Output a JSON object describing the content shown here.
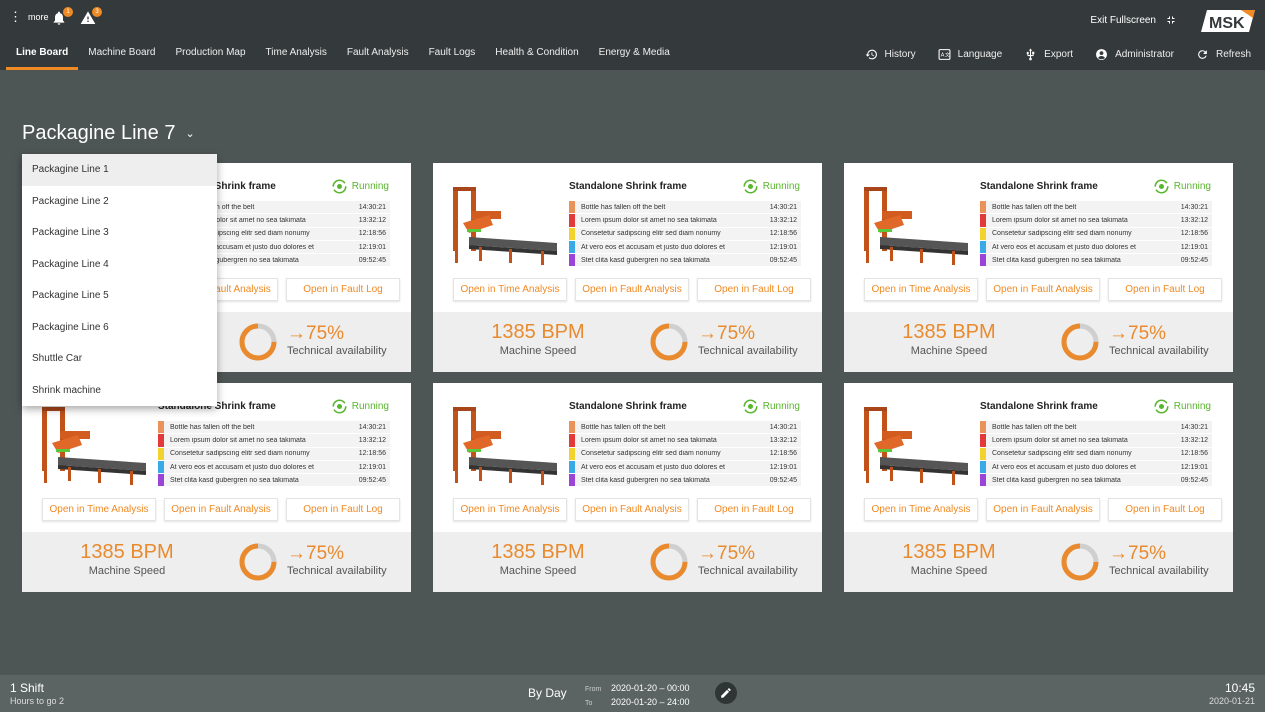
{
  "header": {
    "more_label": "more",
    "notification_count": "1",
    "warning_count": "3",
    "exit_fullscreen": "Exit Fullscreen",
    "logo": "MSK",
    "tabs": [
      {
        "label": "Line Board",
        "active": true
      },
      {
        "label": "Machine Board"
      },
      {
        "label": "Production Map"
      },
      {
        "label": "Time Analysis"
      },
      {
        "label": "Fault Analysis"
      },
      {
        "label": "Fault Logs"
      },
      {
        "label": "Health & Condition"
      },
      {
        "label": "Energy & Media"
      }
    ],
    "tools": {
      "history": "History",
      "language": "Language",
      "export": "Export",
      "user": "Administrator",
      "refresh": "Refresh"
    }
  },
  "page": {
    "title": "Packagine Line 7"
  },
  "dropdown": {
    "items": [
      "Packagine Line 1",
      "Packagine Line 2",
      "Packagine Line 3",
      "Packagine Line 4",
      "Packagine Line 5",
      "Packagine Line 6",
      "Shuttle Car",
      "Shrink machine"
    ],
    "highlighted_index": 0
  },
  "card": {
    "title": "Standalone Shrink frame",
    "status": "Running",
    "faults": [
      {
        "text": "Bottle has fallen off the belt",
        "time": "14:30:21",
        "color": "#e9925a"
      },
      {
        "text": "Lorem ipsum dolor sit amet no sea takimata",
        "time": "13:32:12",
        "color": "#e23a3a"
      },
      {
        "text": "Consetetur sadipscing elitr sed diam nonumy",
        "time": "12:18:56",
        "color": "#f2d22e"
      },
      {
        "text": "At vero eos et accusam et justo duo dolores et",
        "time": "12:19:01",
        "color": "#3aa9e8"
      },
      {
        "text": "Stet clita kasd gubergren no sea takimata",
        "time": "09:52:45",
        "color": "#9b45d8"
      }
    ],
    "buttons": {
      "time_analysis": "Open in Time Analysis",
      "fault_analysis": "Open in Fault Analysis",
      "fault_log": "Open in Fault Log"
    },
    "speed_value": "1385 BPM",
    "speed_label": "Machine Speed",
    "availability_value": "75%",
    "availability_fraction": 0.75,
    "availability_label": "Technical availability"
  },
  "footer": {
    "shift": "1 Shift",
    "hours": "Hours to go 2",
    "mode": "By Day",
    "from_label": "From",
    "to_label": "To",
    "from_value": "2020-01-20 – 00:00",
    "to_value": "2020-01-20 – 24:00",
    "time": "10:45",
    "date": "2020-01-21"
  },
  "colors": {
    "accent": "#f08a24",
    "running": "#59b52d"
  }
}
